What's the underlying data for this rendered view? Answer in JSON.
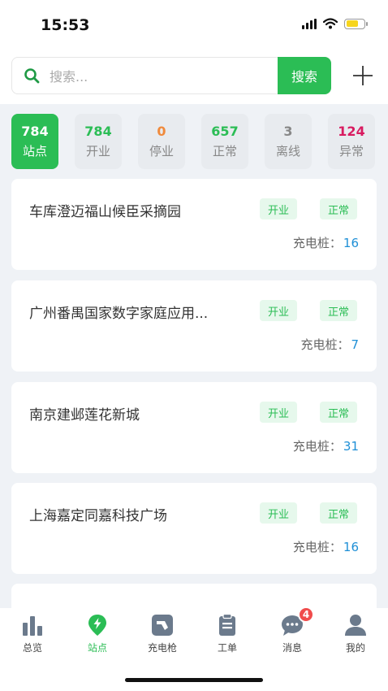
{
  "status_bar": {
    "time": "15:53"
  },
  "search": {
    "placeholder": "搜索...",
    "button_label": "搜索"
  },
  "stats": [
    {
      "value": "784",
      "label": "站点",
      "color": "#ffffff",
      "active": true
    },
    {
      "value": "784",
      "label": "开业",
      "color": "#2bbd55"
    },
    {
      "value": "0",
      "label": "停业",
      "color": "#f08a3c"
    },
    {
      "value": "657",
      "label": "正常",
      "color": "#2bbd55"
    },
    {
      "value": "3",
      "label": "离线",
      "color": "#888888"
    },
    {
      "value": "124",
      "label": "异常",
      "color": "#d81b60"
    }
  ],
  "stations": [
    {
      "name": "车库澄迈福山候臣采摘园",
      "tag_open": "开业",
      "tag_status": "正常",
      "piles_label": "充电桩：",
      "piles": "16"
    },
    {
      "name": "广州番禺国家数字家庭应用...",
      "tag_open": "开业",
      "tag_status": "正常",
      "piles_label": "充电桩：",
      "piles": "7"
    },
    {
      "name": "南京建邺莲花新城",
      "tag_open": "开业",
      "tag_status": "正常",
      "piles_label": "充电桩：",
      "piles": "31"
    },
    {
      "name": "上海嘉定同嘉科技广场",
      "tag_open": "开业",
      "tag_status": "正常",
      "piles_label": "充电桩：",
      "piles": "16"
    },
    {
      "name": "",
      "tag_open": "",
      "tag_status": "",
      "piles_label": "",
      "piles": ""
    }
  ],
  "tabbar": {
    "items": [
      {
        "label": "总览",
        "icon": "bar-chart-icon"
      },
      {
        "label": "站点",
        "icon": "location-bolt-icon",
        "active": true
      },
      {
        "label": "充电枪",
        "icon": "charging-gun-icon"
      },
      {
        "label": "工单",
        "icon": "clipboard-icon"
      },
      {
        "label": "消息",
        "icon": "chat-bubble-icon",
        "badge": "4"
      },
      {
        "label": "我的",
        "icon": "person-icon"
      }
    ]
  },
  "colors": {
    "accent": "#2bbd55",
    "link": "#1e8fd6",
    "background": "#eff2f6",
    "badge": "#f04c4c"
  }
}
